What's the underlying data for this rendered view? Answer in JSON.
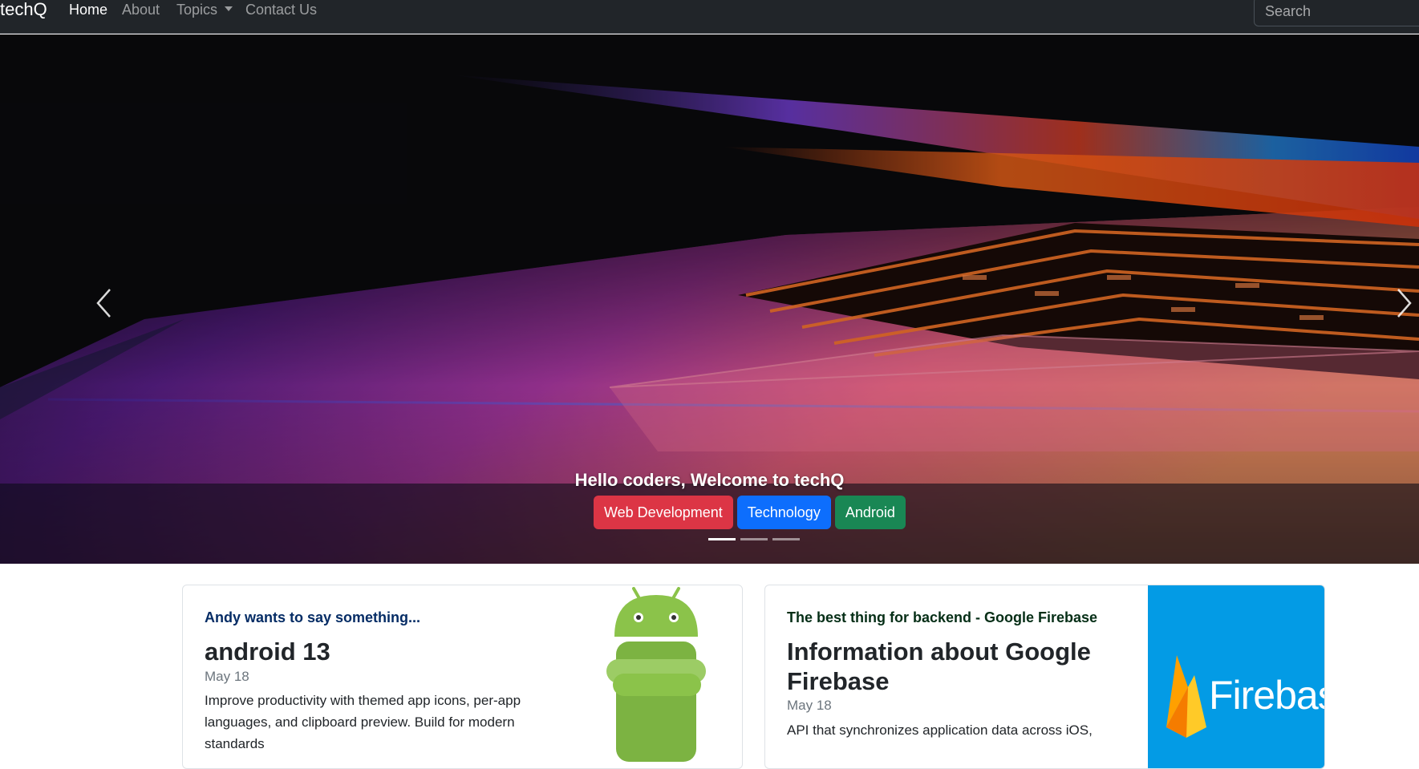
{
  "navbar": {
    "brand": "techQ",
    "items": [
      {
        "label": "Home"
      },
      {
        "label": "About"
      },
      {
        "label": "Topics"
      },
      {
        "label": "Contact Us"
      }
    ],
    "search_placeholder": "Search"
  },
  "hero": {
    "caption_title": "Hello coders, Welcome to techQ",
    "tags": [
      {
        "label": "Web Development",
        "color": "#dc3545"
      },
      {
        "label": "Technology",
        "color": "#0d6efd"
      },
      {
        "label": "Android",
        "color": "#198754"
      }
    ],
    "slides_total": 3,
    "active_slide": 1
  },
  "cards": [
    {
      "kicker": "Andy wants to say something...",
      "title": "android 13",
      "date": "May 18",
      "text": "Improve productivity with themed app icons, per-app languages, and clipboard preview. Build for modern standards",
      "image_icon": "android-icon"
    },
    {
      "kicker": "The best thing for backend - Google Firebase",
      "title": "Information about Google Firebase",
      "date": "May 18",
      "text": "API that synchronizes application data across iOS,",
      "image_icon": "firebase-icon",
      "image_label": "Firebase"
    }
  ]
}
